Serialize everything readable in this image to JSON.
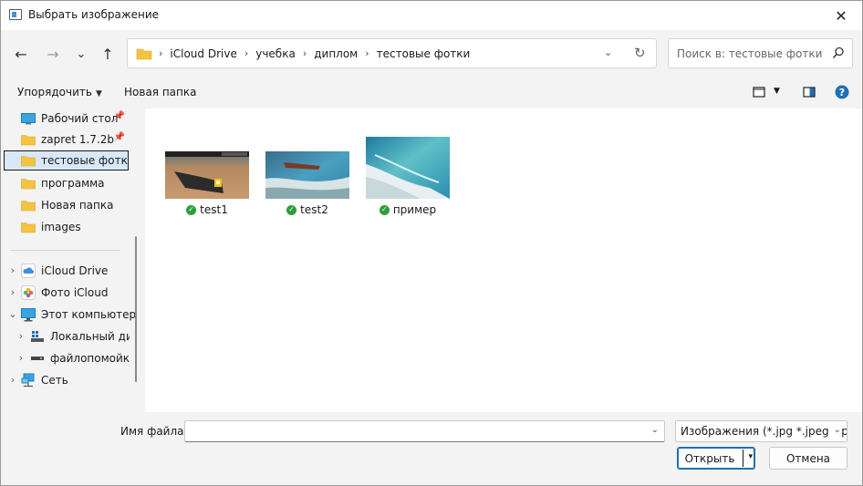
{
  "window": {
    "title": "Выбрать изображение",
    "close": "✕"
  },
  "nav": {
    "back": "←",
    "forward": "→",
    "recent": "⌄",
    "up": "↑"
  },
  "address": {
    "crumbs": [
      "iCloud Drive",
      "учебка",
      "диплом",
      "тестовые фотки"
    ],
    "separator": "›",
    "dropdown": "⌄",
    "refresh": "↻"
  },
  "search": {
    "placeholder": "Поиск в: тестовые фотки"
  },
  "toolbar": {
    "organize": "Упорядочить",
    "organize_caret": "▼",
    "new_folder": "Новая папка",
    "view_caret": "▼",
    "help": "?"
  },
  "sidebar": {
    "quick": [
      {
        "label": "Рабочий стол",
        "icon": "desktop-icon",
        "pinned": true
      },
      {
        "label": "zapret 1.7.2b",
        "icon": "folder-icon",
        "pinned": true
      },
      {
        "label": "тестовые фотки",
        "icon": "folder-icon",
        "selected": true
      },
      {
        "label": "программа",
        "icon": "folder-icon"
      },
      {
        "label": "Новая папка",
        "icon": "folder-icon"
      },
      {
        "label": "images",
        "icon": "folder-icon"
      }
    ],
    "tree": [
      {
        "label": "iCloud Drive",
        "icon": "icloud-icon",
        "chevron": "›"
      },
      {
        "label": "Фото iCloud",
        "icon": "photos-icon",
        "chevron": "›"
      },
      {
        "label": "Этот компьютер",
        "icon": "computer-icon",
        "chevron": "⌄"
      },
      {
        "label": "Локальный диск",
        "icon": "drive-icon",
        "chevron": "›"
      },
      {
        "label": "файлопомойка",
        "icon": "drive-icon",
        "chevron": "›"
      },
      {
        "label": "Сеть",
        "icon": "network-icon",
        "chevron": "›"
      }
    ],
    "pin_glyph": "📌"
  },
  "files": [
    {
      "name": "test1",
      "status": "synced"
    },
    {
      "name": "test2",
      "status": "synced"
    },
    {
      "name": "пример",
      "status": "synced"
    }
  ],
  "status_check": "✓",
  "bottom": {
    "filename_label": "Имя файла:",
    "filename_value": "",
    "filetype": "Изображения (*.jpg *.jpeg *.pr",
    "dropdown": "⌄",
    "open": "Открыть",
    "open_caret": "▾",
    "cancel": "Отмена"
  },
  "colors": {
    "accent": "#1f6fb5",
    "selected_bg": "#d9e8f7",
    "folder": "#f5c342",
    "synced": "#2d9e3a"
  }
}
